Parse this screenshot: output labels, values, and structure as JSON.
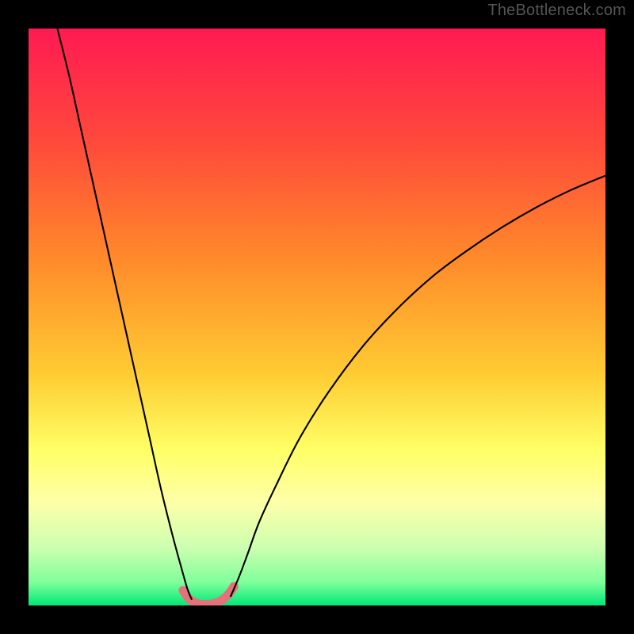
{
  "watermark": "TheBottleneck.com",
  "chart_data": {
    "type": "line",
    "title": "",
    "xlabel": "",
    "ylabel": "",
    "xlim": [
      0,
      100
    ],
    "ylim": [
      0,
      100
    ],
    "gradient_stops": [
      {
        "pos": 0,
        "color": "#ff1a52"
      },
      {
        "pos": 20,
        "color": "#ff4a3b"
      },
      {
        "pos": 40,
        "color": "#ff8a2a"
      },
      {
        "pos": 60,
        "color": "#ffcc33"
      },
      {
        "pos": 73,
        "color": "#ffff66"
      },
      {
        "pos": 82,
        "color": "#ffffa8"
      },
      {
        "pos": 90,
        "color": "#ccffb0"
      },
      {
        "pos": 96,
        "color": "#7fff9a"
      },
      {
        "pos": 100,
        "color": "#00e878"
      }
    ],
    "series": [
      {
        "name": "left-branch",
        "x": [
          5,
          7,
          9,
          11,
          13,
          15,
          17,
          19,
          21,
          23,
          25,
          26.5,
          27.5,
          28.3
        ],
        "y": [
          100,
          92,
          83,
          74,
          65,
          56,
          47,
          38,
          29,
          20,
          12,
          6.5,
          3,
          1
        ]
      },
      {
        "name": "right-branch",
        "x": [
          35,
          36.5,
          38,
          40,
          43,
          47,
          52,
          58,
          64,
          70,
          76,
          82,
          88,
          94,
          100
        ],
        "y": [
          1.5,
          5,
          9,
          14.5,
          21,
          29,
          37,
          45,
          51.5,
          57,
          61.5,
          65.5,
          69,
          72,
          74.5
        ]
      },
      {
        "name": "trough-highlight",
        "x": [
          26.8,
          27.7,
          28.6,
          29.6,
          30.6,
          31.7,
          32.8,
          33.9,
          34.8,
          35.6
        ],
        "y": [
          2.6,
          1.3,
          0.6,
          0.25,
          0.2,
          0.25,
          0.55,
          1.2,
          2.1,
          3.3
        ]
      }
    ],
    "trough_style": {
      "stroke": "#e6717a",
      "stroke_width": 11,
      "dot_radius": 5.6
    },
    "curve_style": {
      "stroke": "#000000",
      "stroke_width": 2.1
    }
  }
}
